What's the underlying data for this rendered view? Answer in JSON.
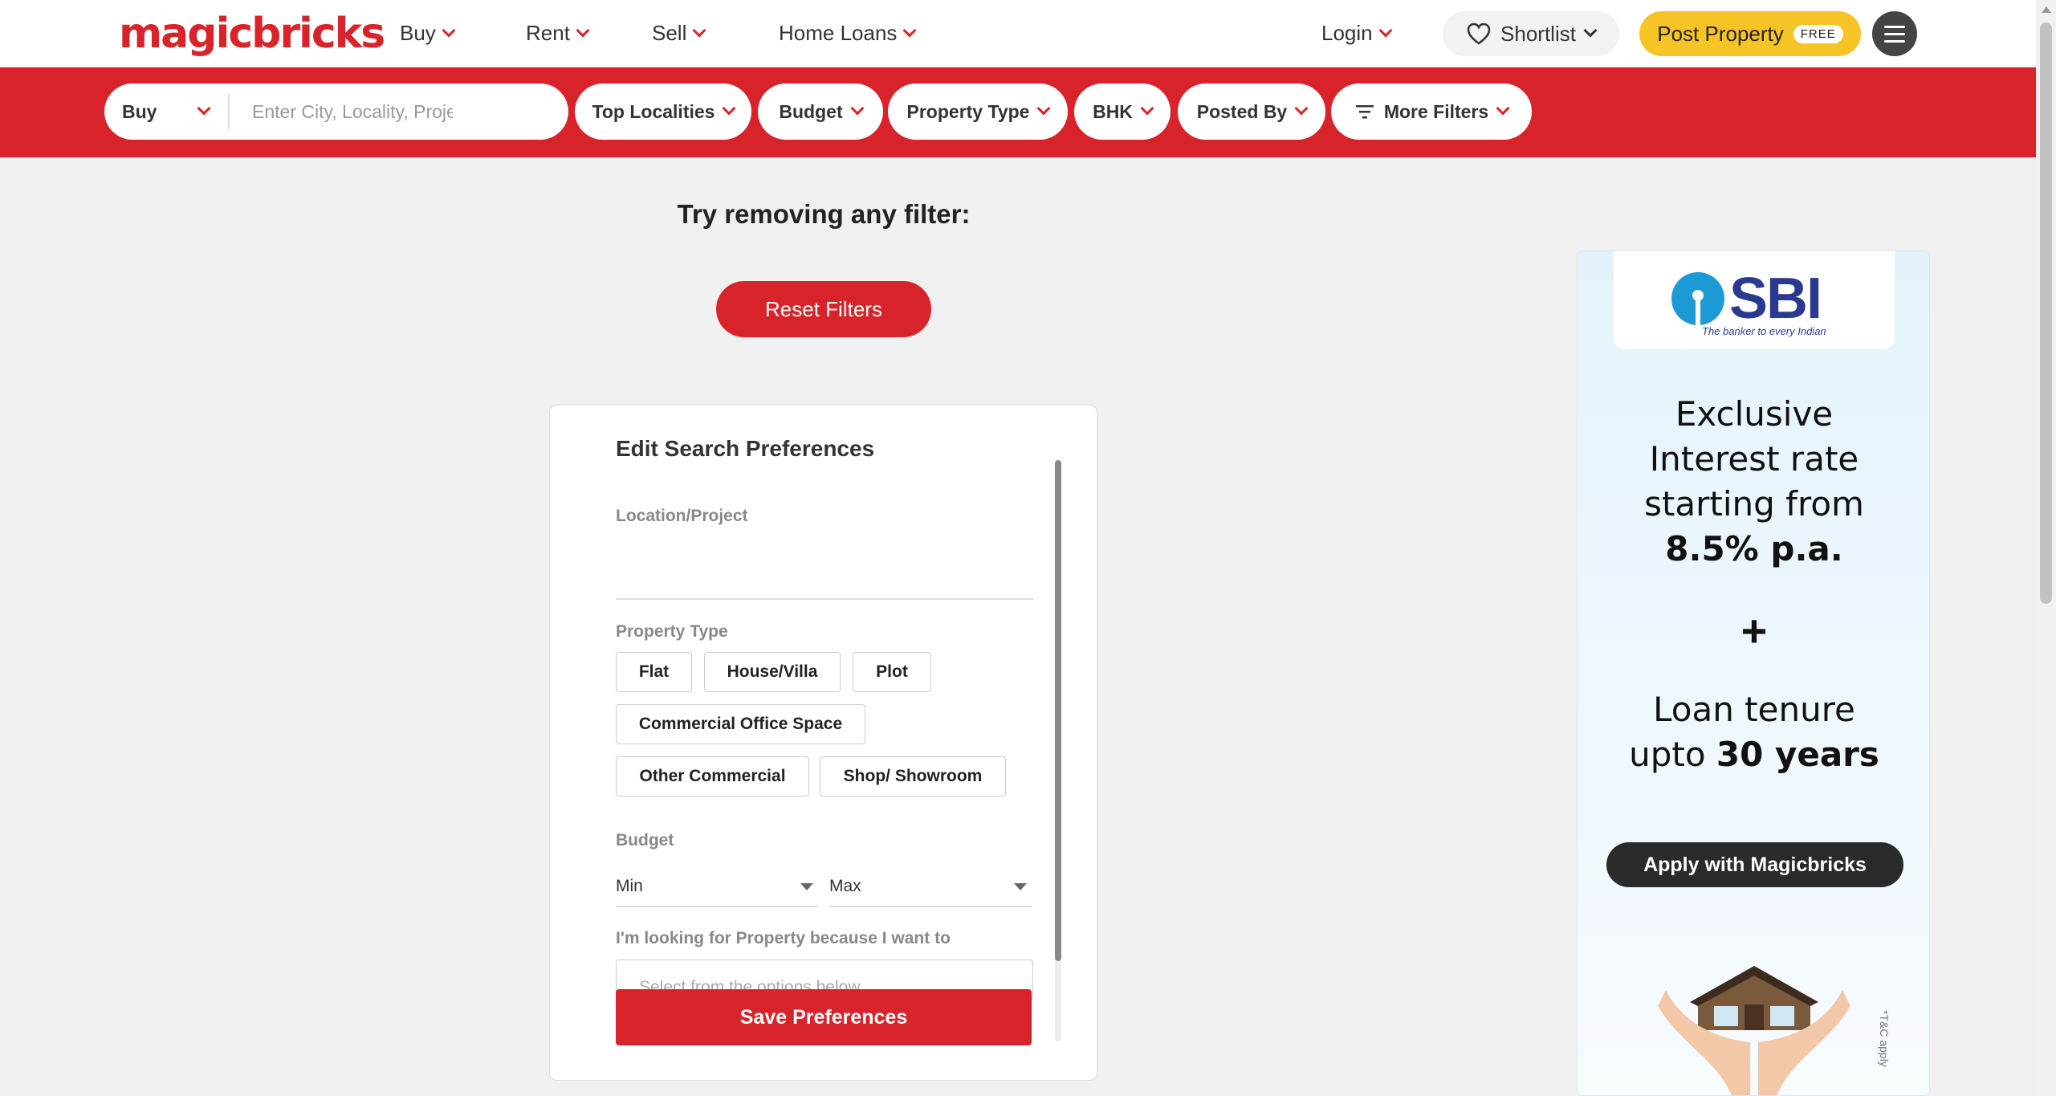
{
  "header": {
    "logo": "magicbricks",
    "nav": [
      {
        "label": "Buy"
      },
      {
        "label": "Rent"
      },
      {
        "label": "Sell"
      },
      {
        "label": "Home Loans"
      }
    ],
    "login": "Login",
    "shortlist": "Shortlist",
    "post_property": "Post Property",
    "free_badge": "FREE"
  },
  "filterbar": {
    "search_type": "Buy",
    "search_placeholder": "Enter City, Locality, Project",
    "filters": [
      "Top Localities",
      "Budget",
      "Property Type",
      "BHK",
      "Posted By",
      "More Filters"
    ]
  },
  "main": {
    "try_text": "Try removing any filter:",
    "reset_button": "Reset Filters"
  },
  "prefs": {
    "title": "Edit Search Preferences",
    "location_label": "Location/Project",
    "property_type_label": "Property Type",
    "property_types": [
      "Flat",
      "House/Villa",
      "Plot",
      "Commercial Office Space",
      "Other Commercial",
      "Shop/ Showroom"
    ],
    "budget_label": "Budget",
    "budget_min": "Min",
    "budget_max": "Max",
    "reason_label": "I'm looking for Property because I want to",
    "reason_placeholder": "Select from the options below",
    "save_button": "Save Preferences"
  },
  "ad": {
    "bank": "SBI",
    "tagline": "The banker to every Indian",
    "line1": "Exclusive",
    "line2": "Interest rate",
    "line3": "starting from",
    "rate": "8.5% p.a.",
    "plus": "+",
    "line4": "Loan tenure",
    "line5_prefix": "upto",
    "tenure": "30 years",
    "apply": "Apply with Magicbricks",
    "tc": "*T&C apply"
  },
  "colors": {
    "brand_red": "#d8232a",
    "post_yellow": "#f6c426"
  }
}
